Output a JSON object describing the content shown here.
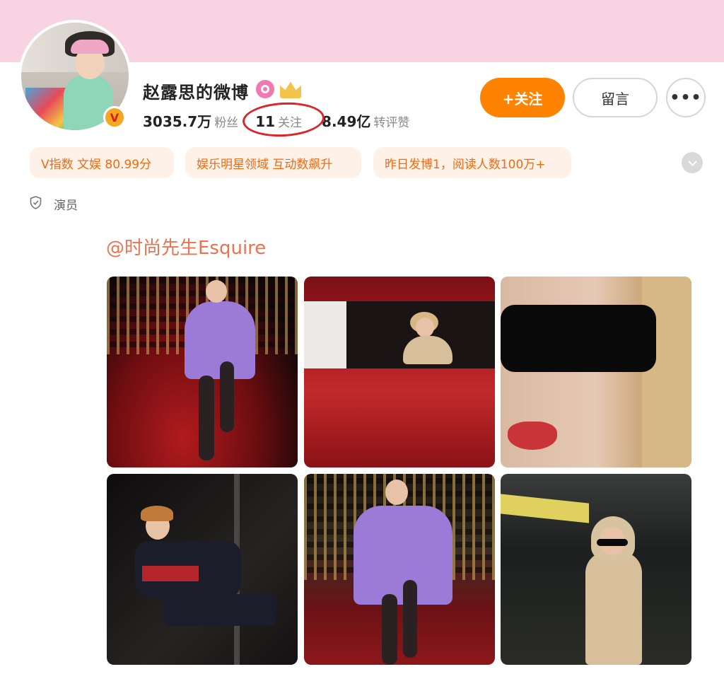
{
  "profile": {
    "name": "赵露思的微博",
    "verified_badge": "V",
    "icons": [
      "vip-ring-icon",
      "crown-icon"
    ],
    "stats": [
      {
        "value": "3035.7万",
        "label": "粉丝"
      },
      {
        "value": "11",
        "label": "关注"
      },
      {
        "value": "8.49亿",
        "label": "转评赞"
      }
    ]
  },
  "actions": {
    "follow_label": "+关注",
    "message_label": "留言",
    "more_label": "•••"
  },
  "tags": [
    "V指数 文娱 80.99分",
    "娱乐明星领域 互动数飙升",
    "昨日发博1，阅读人数100万+"
  ],
  "role": "演员",
  "post": {
    "mention": "@时尚先生Esquire"
  },
  "colors": {
    "banner": "#f8d3e1",
    "accent": "#ff8200",
    "tag_text": "#f26a13",
    "tag_bg": "#fdf1e8",
    "mention": "#eb7350",
    "highlight_circle": "#d9262b"
  }
}
